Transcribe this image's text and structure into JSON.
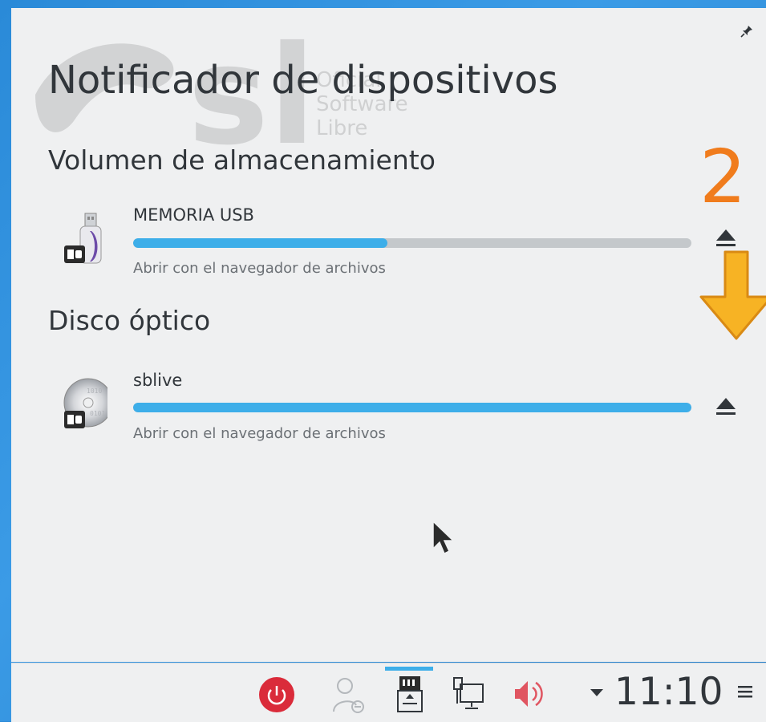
{
  "popup": {
    "title": "Notificador de dispositivos",
    "watermark": {
      "brand": "sl",
      "line1": "Oficial",
      "line2": "Software",
      "line3": "Libre"
    },
    "pin_icon": "pin-icon",
    "sections": [
      {
        "heading": "Volumen de almacenamiento",
        "device": {
          "name": "MEMORIA USB",
          "icon": "usb-drive-icon",
          "usage_fraction": 0.455,
          "action": "Abrir con el navegador de archivos",
          "eject_icon": "eject-icon"
        }
      },
      {
        "heading": "Disco óptico",
        "device": {
          "name": "sblive",
          "icon": "optical-disc-icon",
          "usage_fraction": 1.0,
          "action": "Abrir con el navegador de archivos",
          "eject_icon": "eject-icon"
        }
      }
    ]
  },
  "annotation": {
    "number": "2",
    "arrow_color": "#f7b324",
    "number_color": "#f07c1d"
  },
  "panel": {
    "tray_icons": [
      "power-icon",
      "user-switch-icon",
      "device-notifier-icon",
      "network-icon",
      "volume-icon"
    ],
    "expand_icon": "chevron-down-icon",
    "clock": "11:10",
    "menu_icon": "hamburger-icon"
  },
  "colors": {
    "accent": "#3daee9",
    "background": "#eff0f1",
    "text": "#31363b",
    "power": "#da2b3a"
  }
}
